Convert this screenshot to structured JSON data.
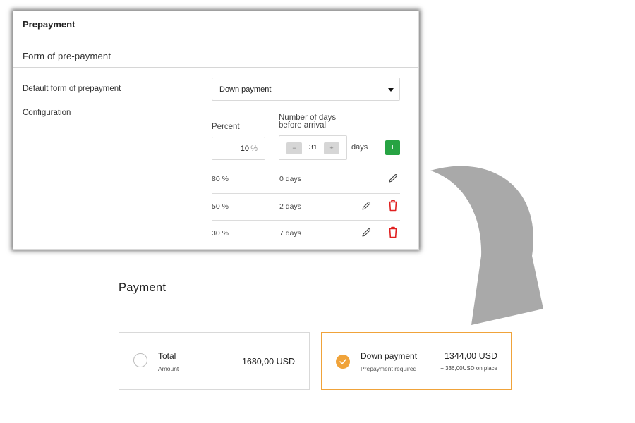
{
  "settings": {
    "card_title": "Prepayment",
    "section_title": "Form of pre-payment",
    "default_form_label": "Default form of prepayment",
    "default_form_value": "Down payment",
    "configuration_label": "Configuration",
    "percent_label": "Percent",
    "days_before_label_line1": "Number of days",
    "days_before_label_line2": "before arrival",
    "percent_value": "10",
    "percent_unit": "%",
    "stepper": {
      "minus": "−",
      "value": "31",
      "plus": "+"
    },
    "days_unit": "days",
    "add_button": "+",
    "tiers": [
      {
        "percent": "80 %",
        "days": "0 days"
      },
      {
        "percent": "50 %",
        "days": "2 days"
      },
      {
        "percent": "30 %",
        "days": "7 days"
      }
    ]
  },
  "payment": {
    "title": "Payment",
    "options": [
      {
        "name": "Total",
        "subtitle": "Amount",
        "amount": "1680,00 USD",
        "selected": false
      },
      {
        "name": "Down payment",
        "subtitle": "Prepayment required",
        "amount": "1344,00 USD",
        "note": "+ 336,00USD on place",
        "selected": true
      }
    ]
  },
  "colors": {
    "accent": "#f0a33a",
    "add_green": "#27a343",
    "delete_red": "#e02020",
    "arrow_gray": "#a9a9a9"
  },
  "icons": [
    "edit-icon",
    "delete-icon",
    "check-icon",
    "curved-arrow-icon",
    "caret-down-icon"
  ]
}
